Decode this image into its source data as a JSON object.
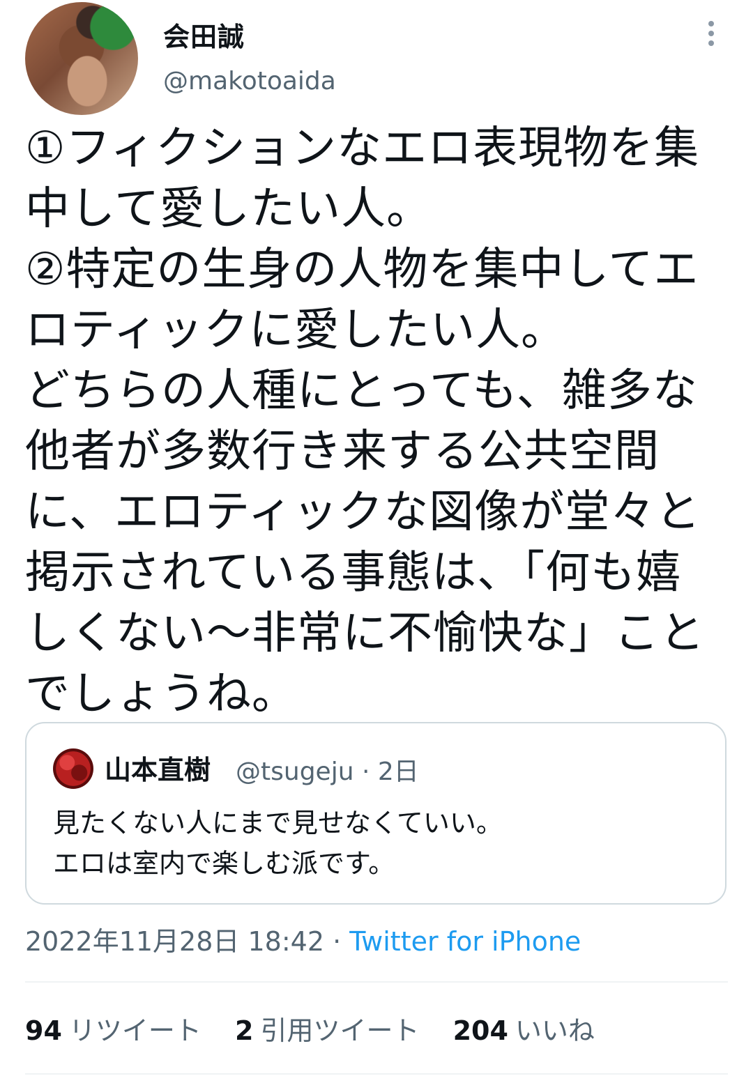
{
  "author": {
    "name": "会田誠",
    "handle": "@makotoaida"
  },
  "tweet": {
    "lines": [
      "①フィクションなエロ表現物を集",
      "中して愛したい人。",
      "②特定の生身の人物を集中してエ",
      "ロティックに愛したい人。",
      "どちらの人種にとっても、雑多な",
      "他者が多数行き来する公共空間",
      "に、エロティックな図像が堂々と",
      "掲示されている事態は、「何も嬉",
      "しくない〜非常に不愉快な」こと",
      "でしょうね。"
    ]
  },
  "quoted": {
    "name": "山本直樹",
    "meta": "@tsugeju · 2日",
    "lines": [
      "見たくない人にまで見せなくていい。",
      "エロは室内で楽しむ派です。"
    ]
  },
  "timestamp": "2022年11月28日 18:42 · ",
  "source": "Twitter for iPhone",
  "stats": {
    "retweets": "94",
    "retweets_label": "リツイート",
    "quotes": "2",
    "quotes_label": "引用ツイート",
    "likes": "204",
    "likes_label": "いいね"
  },
  "colors": {
    "link": "#1d9bf0",
    "secondary": "#536471"
  }
}
